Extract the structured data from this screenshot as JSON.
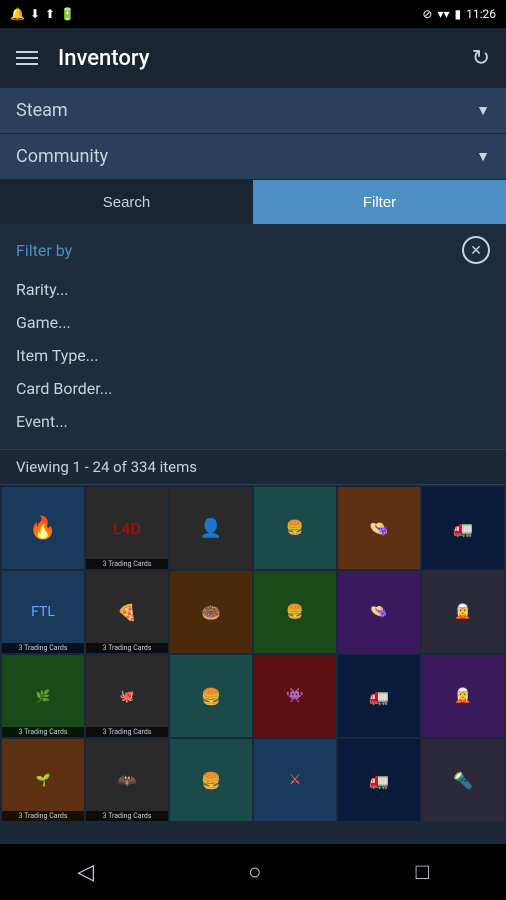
{
  "statusBar": {
    "time": "11:26",
    "icons": [
      "notification",
      "wifi",
      "battery"
    ]
  },
  "appBar": {
    "title": "Inventory",
    "refreshLabel": "↻"
  },
  "dropdowns": [
    {
      "label": "Steam",
      "id": "steam-dropdown"
    },
    {
      "label": "Community",
      "id": "community-dropdown"
    }
  ],
  "tabs": [
    {
      "label": "Search",
      "active": false
    },
    {
      "label": "Filter",
      "active": true
    }
  ],
  "filterSection": {
    "title": "Filter by",
    "closeLabel": "✕",
    "items": [
      "Rarity...",
      "Game...",
      "Item Type...",
      "Card Border...",
      "Event..."
    ]
  },
  "viewingCount": "Viewing 1 - 24 of 334 items",
  "gridItems": [
    {
      "color": "color-blue",
      "label": "",
      "badge": ""
    },
    {
      "color": "color-dark",
      "label": "",
      "badge": "3 Trading Cards"
    },
    {
      "color": "color-dark",
      "label": "",
      "badge": ""
    },
    {
      "color": "color-teal",
      "label": "",
      "badge": ""
    },
    {
      "color": "color-orange",
      "label": "",
      "badge": ""
    },
    {
      "color": "color-navy",
      "label": "",
      "badge": ""
    },
    {
      "color": "color-blue",
      "label": "",
      "badge": "3 Trading Cards"
    },
    {
      "color": "color-dark",
      "label": "",
      "badge": "3 Trading Cards"
    },
    {
      "color": "color-brown",
      "label": "",
      "badge": ""
    },
    {
      "color": "color-green",
      "label": "",
      "badge": ""
    },
    {
      "color": "color-purple",
      "label": "",
      "badge": ""
    },
    {
      "color": "color-gray",
      "label": "",
      "badge": ""
    },
    {
      "color": "color-green",
      "label": "",
      "badge": "3 Trading Cards"
    },
    {
      "color": "color-dark",
      "label": "",
      "badge": "3 Trading Cards"
    },
    {
      "color": "color-teal",
      "label": "",
      "badge": ""
    },
    {
      "color": "color-red",
      "label": "",
      "badge": ""
    },
    {
      "color": "color-navy",
      "label": "",
      "badge": ""
    },
    {
      "color": "color-purple",
      "label": "",
      "badge": ""
    },
    {
      "color": "color-orange",
      "label": "",
      "badge": "3 Trading Cards"
    },
    {
      "color": "color-dark",
      "label": "",
      "badge": "3 Trading Cards"
    },
    {
      "color": "color-teal",
      "label": "",
      "badge": ""
    },
    {
      "color": "color-blue",
      "label": "",
      "badge": ""
    },
    {
      "color": "color-navy",
      "label": "",
      "badge": ""
    },
    {
      "color": "color-gray",
      "label": "",
      "badge": ""
    }
  ],
  "navBar": {
    "backLabel": "◁",
    "homeLabel": "○",
    "recentLabel": "□"
  }
}
